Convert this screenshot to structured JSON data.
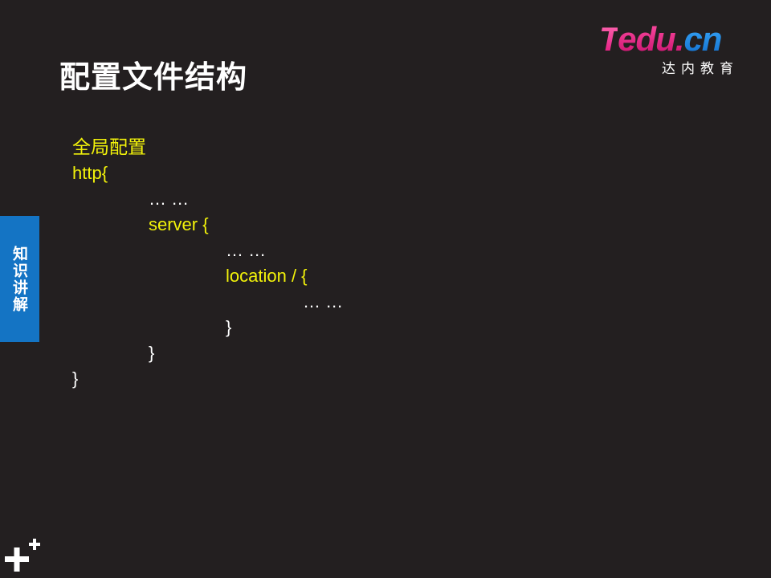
{
  "slide": {
    "title": "配置文件结构",
    "side_tab_label": "知识讲解"
  },
  "logo": {
    "word_t": "T",
    "word_edu": "edu.",
    "word_cn": "cn",
    "subtitle": "达内教育"
  },
  "code": {
    "lines": [
      {
        "text": "全局配置",
        "indent": 0,
        "color": "yellow"
      },
      {
        "text": "http{",
        "indent": 0,
        "color": "yellow"
      },
      {
        "text": "… …",
        "indent": 1,
        "color": "white"
      },
      {
        "text": "server {",
        "indent": 1,
        "color": "yellow"
      },
      {
        "text": "… …",
        "indent": 2,
        "color": "white"
      },
      {
        "text": "location / {",
        "indent": 2,
        "color": "yellow"
      },
      {
        "text": "… …",
        "indent": 3,
        "color": "white"
      },
      {
        "text": "}",
        "indent": 2,
        "color": "white"
      },
      {
        "text": "}",
        "indent": 1,
        "color": "white"
      },
      {
        "text": "}",
        "indent": 0,
        "color": "white"
      }
    ]
  },
  "colors": {
    "background": "#231f20",
    "code_text": "#f2f20a",
    "side_tab": "#1474c4",
    "logo_pink": "#e0117a",
    "logo_blue": "#0f6ccc"
  },
  "icons": {
    "corner": "plus-icon"
  }
}
